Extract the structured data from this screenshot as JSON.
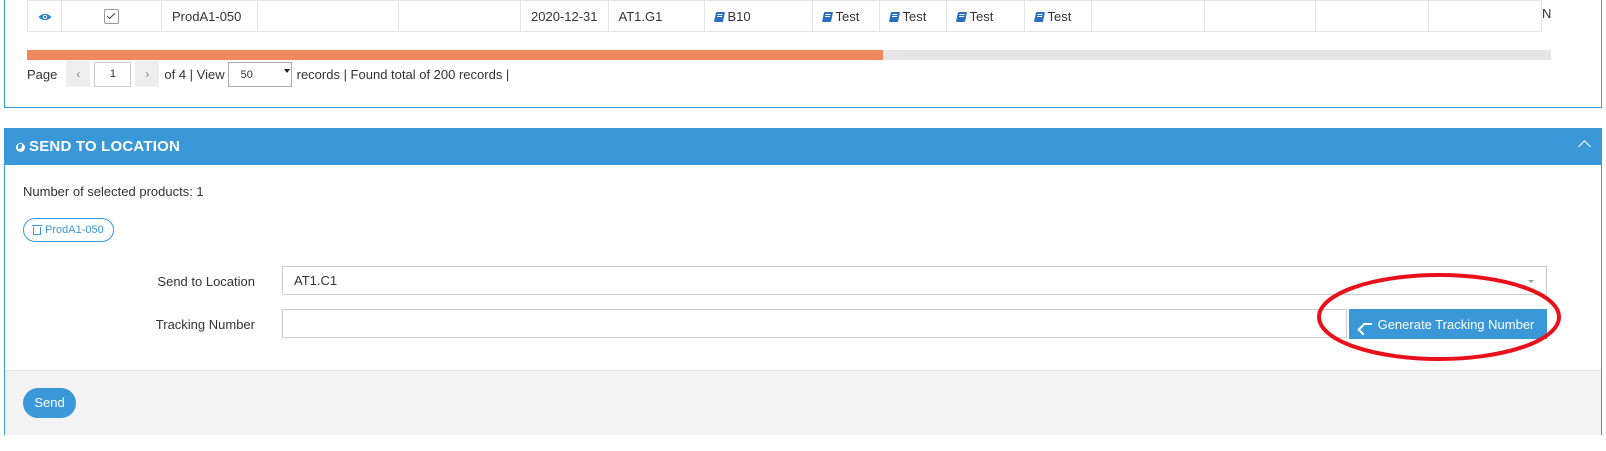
{
  "table": {
    "row": {
      "product": "ProdA1-050",
      "date": "2020-12-31",
      "location": "AT1.G1",
      "col_b": "B10",
      "test_cells": [
        "Test",
        "Test",
        "Test",
        "Test"
      ],
      "trailing": "N"
    }
  },
  "scroll": {
    "position": 0.562
  },
  "pager": {
    "page_label": "Page",
    "prev_label": "‹",
    "next_label": "›",
    "current_page": "1",
    "of_label": "of 4 | View",
    "per_page": "50",
    "records_label": "records | Found total of 200 records |"
  },
  "send_panel": {
    "title": "SEND TO LOCATION",
    "selected_count_text": "Number of selected products: 1",
    "selected_product": "ProdA1-050",
    "location_label": "Send to Location",
    "location_value": "AT1.C1",
    "tracking_label": "Tracking Number",
    "tracking_value": "",
    "generate_label": "Generate Tracking Number",
    "send_label": "Send"
  },
  "colors": {
    "accent": "#3a97d8",
    "scroll_thumb": "#f0885f",
    "annotation": "#e8101a"
  }
}
